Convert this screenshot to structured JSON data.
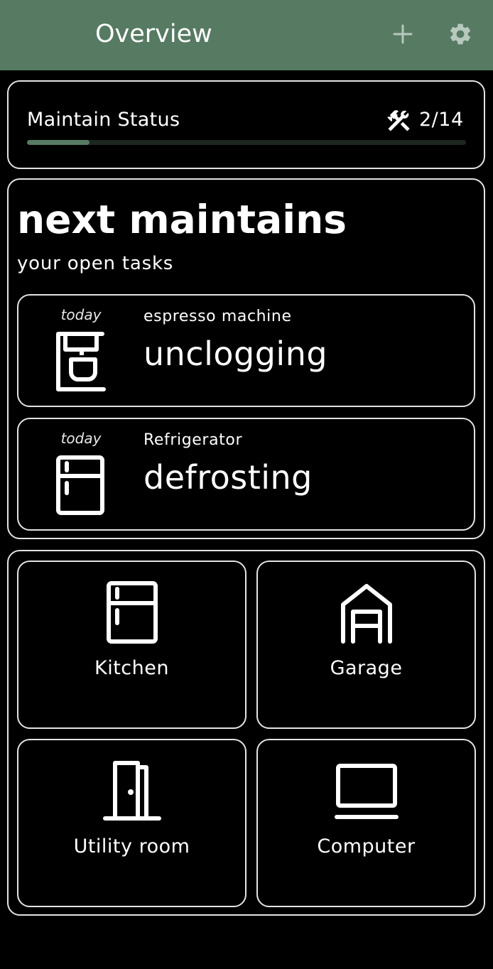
{
  "appbar": {
    "title": "Overview",
    "add_icon": "plus-icon",
    "settings_icon": "gear-icon",
    "background": "#577a63"
  },
  "status": {
    "label": "Maintain Status",
    "icon": "tools-icon",
    "done": 2,
    "total": 14,
    "count_text": "2/14",
    "progress_fraction": 0.143
  },
  "next": {
    "title": "next maintains",
    "subtitle": "your open tasks",
    "tasks": [
      {
        "when": "today",
        "device": "espresso machine",
        "action": "unclogging",
        "icon": "espresso-machine-icon"
      },
      {
        "when": "today",
        "device": "Refrigerator",
        "action": "defrosting",
        "icon": "fridge-icon"
      }
    ]
  },
  "rooms": [
    {
      "label": "Kitchen",
      "icon": "fridge-icon"
    },
    {
      "label": "Garage",
      "icon": "garage-icon"
    },
    {
      "label": "Utility room",
      "icon": "door-icon"
    },
    {
      "label": "Computer",
      "icon": "laptop-icon"
    }
  ]
}
